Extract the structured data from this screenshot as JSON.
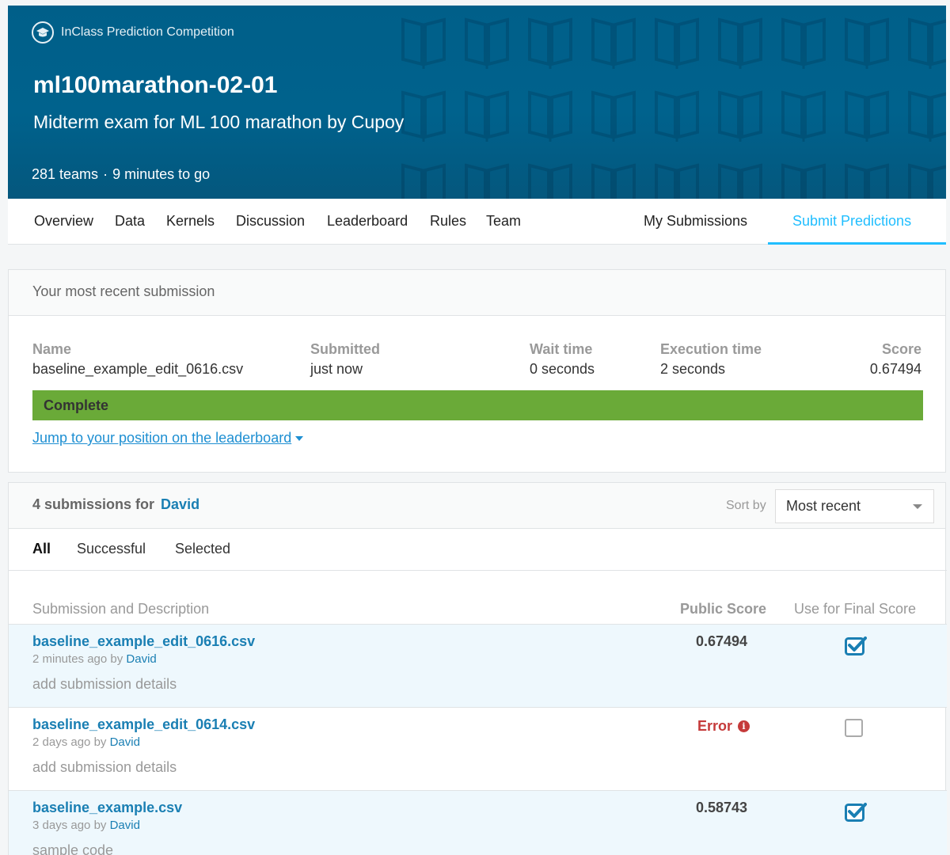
{
  "hero": {
    "badge": "InClass Prediction Competition",
    "title": "ml100marathon-02-01",
    "subtitle": "Midterm exam for ML 100 marathon by Cupoy",
    "teams": "281 teams",
    "time_left": "9 minutes to go"
  },
  "nav": {
    "items": [
      "Overview",
      "Data",
      "Kernels",
      "Discussion",
      "Leaderboard",
      "Rules",
      "Team"
    ],
    "my_submissions": "My Submissions",
    "submit_predictions": "Submit Predictions"
  },
  "recent": {
    "title": "Your most recent submission",
    "labels": {
      "name": "Name",
      "submitted": "Submitted",
      "wait": "Wait time",
      "exec": "Execution time",
      "score": "Score"
    },
    "values": {
      "name": "baseline_example_edit_0616.csv",
      "submitted": "just now",
      "wait": "0 seconds",
      "exec": "2 seconds",
      "score": "0.67494"
    },
    "status": "Complete",
    "status_color": "#6aaa38",
    "jump_link": "Jump to your position on the leaderboard"
  },
  "submissions": {
    "count_label": "4 submissions for",
    "user": "David",
    "sort_label": "Sort by",
    "sort_value": "Most recent",
    "filters": [
      "All",
      "Successful",
      "Selected"
    ],
    "headers": {
      "desc": "Submission and Description",
      "public": "Public Score",
      "final": "Use for Final Score"
    },
    "rows": [
      {
        "file": "baseline_example_edit_0616.csv",
        "ago": "2 minutes ago",
        "by": "by",
        "user": "David",
        "desc": "add submission details",
        "score": "0.67494",
        "selected": true
      },
      {
        "file": "baseline_example_edit_0614.csv",
        "ago": "2 days ago",
        "by": "by",
        "user": "David",
        "desc": "add submission details",
        "score": "Error",
        "selected": false
      },
      {
        "file": "baseline_example.csv",
        "ago": "3 days ago",
        "by": "by",
        "user": "David",
        "desc": "sample code",
        "score": "0.58743",
        "selected": true
      }
    ]
  },
  "colors": {
    "accent": "#20beff",
    "link": "#1a7fb3",
    "hero": "#00628d",
    "error": "#c53a3a",
    "checked": "#1a7fb3"
  }
}
